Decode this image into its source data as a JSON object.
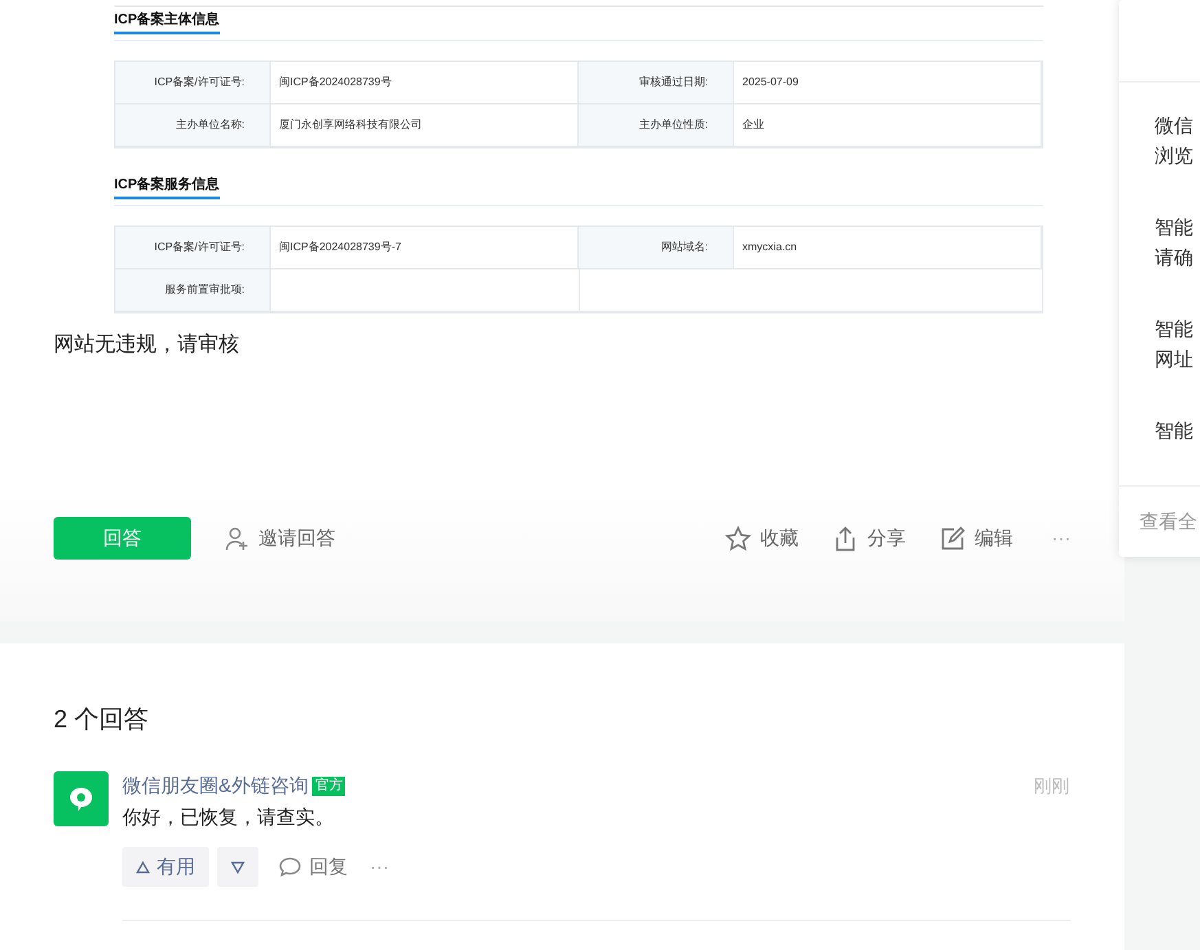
{
  "record_screenshot": {
    "sections": [
      {
        "title": "ICP备案主体信息",
        "rows": [
          [
            {
              "label": "ICP备案/许可证号:",
              "value": "闽ICP备2024028739号"
            },
            {
              "label": "审核通过日期:",
              "value": "2025-07-09"
            }
          ],
          [
            {
              "label": "主办单位名称:",
              "value": "厦门永创享网络科技有限公司"
            },
            {
              "label": "主办单位性质:",
              "value": "企业"
            }
          ]
        ]
      },
      {
        "title": "ICP备案服务信息",
        "rows": [
          [
            {
              "label": "ICP备案/许可证号:",
              "value": "闽ICP备2024028739号-7"
            },
            {
              "label": "网站域名:",
              "value": "xmycxia.cn"
            }
          ],
          [
            {
              "label": "服务前置审批项:"
            }
          ]
        ]
      }
    ]
  },
  "question_text": "网站无违规，请审核",
  "answer_button": "回答",
  "invite_button": "邀请回答",
  "actions": [
    {
      "kind": "star",
      "label": "收藏"
    },
    {
      "kind": "share",
      "label": "分享"
    },
    {
      "kind": "edit",
      "label": "编辑"
    },
    {
      "kind": "more",
      "label": "···"
    }
  ],
  "answers_heading": "2 个回答",
  "answers": [
    {
      "author": "微信朋友圈&外链咨询",
      "badge": "官方",
      "time": "刚刚",
      "text": "你好，已恢复，请查实。",
      "useful": "有用",
      "reply": "回复",
      "more": "···"
    }
  ],
  "side_panel": {
    "items": [
      {
        "line1": "微信",
        "line2": "浏览"
      },
      {
        "line1": "智能",
        "line2": "请确"
      },
      {
        "line1": "智能",
        "line2": "网址"
      },
      {
        "line1": "智能"
      }
    ],
    "footer": "查看全"
  }
}
